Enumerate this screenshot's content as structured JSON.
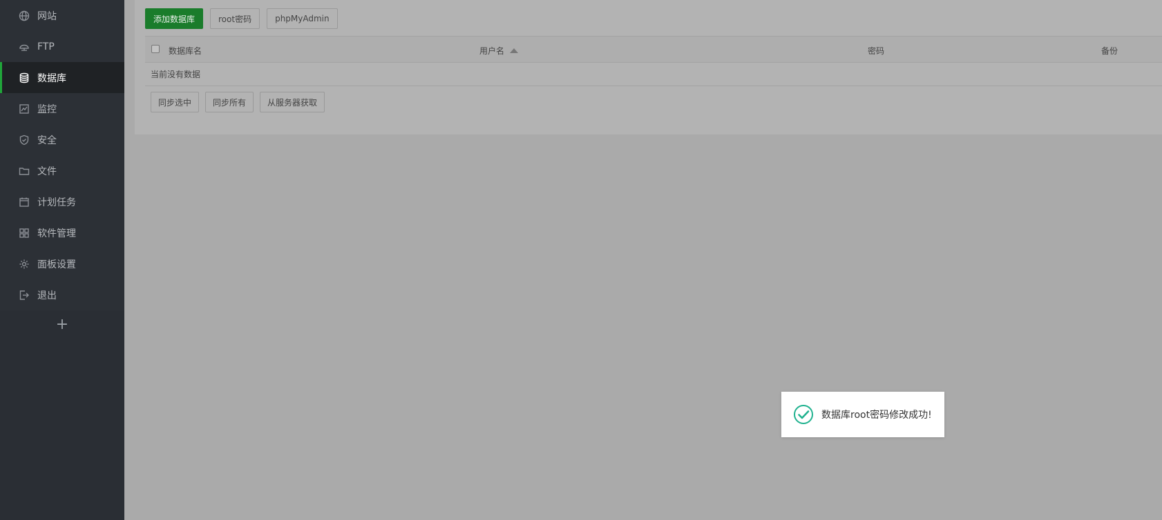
{
  "sidebar": {
    "items": [
      {
        "label": "网站",
        "icon": "globe-icon"
      },
      {
        "label": "FTP",
        "icon": "ftp-server-icon"
      },
      {
        "label": "数据库",
        "icon": "database-icon",
        "active": true
      },
      {
        "label": "监控",
        "icon": "monitor-icon"
      },
      {
        "label": "安全",
        "icon": "shield-icon"
      },
      {
        "label": "文件",
        "icon": "folder-icon"
      },
      {
        "label": "计划任务",
        "icon": "calendar-icon"
      },
      {
        "label": "软件管理",
        "icon": "apps-grid-icon"
      },
      {
        "label": "面板设置",
        "icon": "gear-icon"
      },
      {
        "label": "退出",
        "icon": "logout-icon"
      }
    ],
    "add_label": "+"
  },
  "toolbar": {
    "add_database": "添加数据库",
    "root_password": "root密码",
    "phpmyadmin": "phpMyAdmin"
  },
  "table": {
    "columns": [
      "数据库名",
      "用户名",
      "密码",
      "备份"
    ],
    "empty_text": "当前没有数据"
  },
  "bottom_actions": {
    "sync_selected": "同步选中",
    "sync_all": "同步所有",
    "fetch_from_server": "从服务器获取"
  },
  "toast": {
    "message": "数据库root密码修改成功!",
    "icon": "check-circle-icon"
  },
  "colors": {
    "accent": "#20a53a",
    "primary_button": "#1a7c2b",
    "sidebar_bg": "#2a2e34",
    "overlay_bg": "#aaaaaa"
  }
}
